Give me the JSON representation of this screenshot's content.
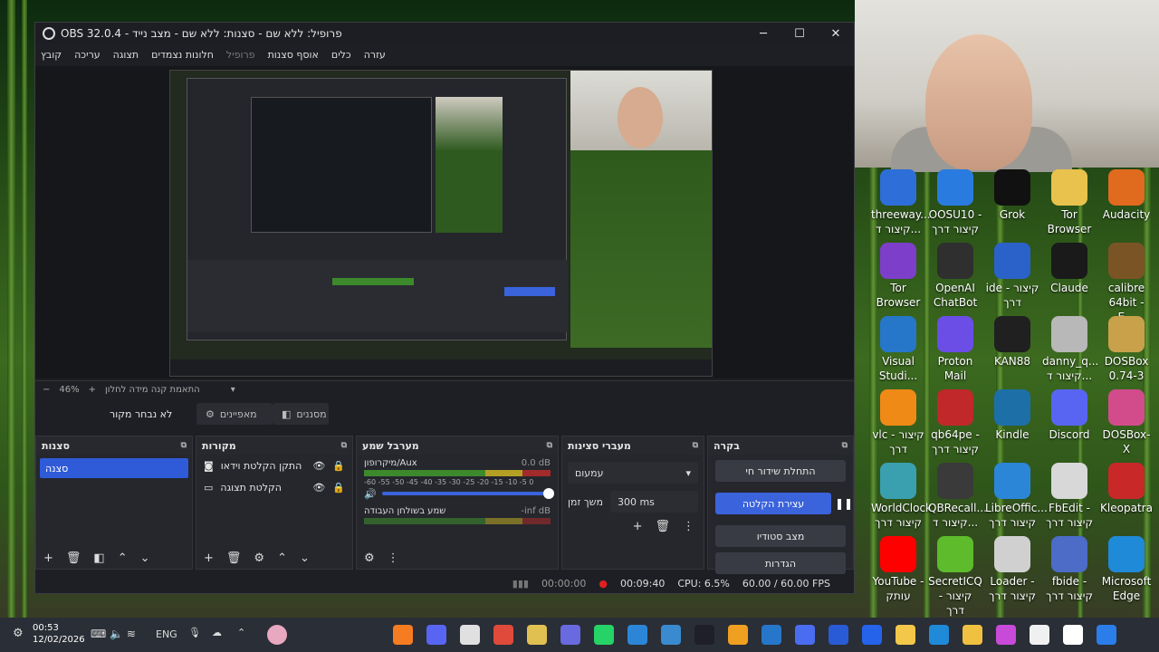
{
  "window": {
    "title": "OBS 32.0.4 - פרופיל: ללא שם - סצנות: ללא שם - מצב נייד"
  },
  "menu": [
    "קובץ",
    "עריכה",
    "תצוגה",
    "חלונות נצמדים",
    "פרופיל",
    "אוסף סצנות",
    "כלים",
    "עזרה"
  ],
  "zoom": {
    "percent": "46%",
    "mode": "התאמת קנה מידה לחלון"
  },
  "source_bar": {
    "no_source": "לא נבחר מקור",
    "properties": "מאפיינים",
    "filters": "מסננים"
  },
  "docks": {
    "scenes": {
      "title": "סצנות",
      "items": [
        "סצנה"
      ]
    },
    "sources": {
      "title": "מקורות",
      "items": [
        "התקן הקלטת וידאו",
        "הקלטת תצוגה"
      ]
    },
    "mixer": {
      "title": "מערבל שמע",
      "ch1_name": "מיקרופון/Aux",
      "ch1_db": "0.0 dB",
      "scale": "-60 -55 -50 -45 -40 -35 -30 -25 -20 -15 -10 -5 0",
      "ch2_name": "שמע בשולחן העבודה",
      "ch2_db": "-inf dB"
    },
    "transitions": {
      "title": "מעברי סצינות",
      "type": "עמעום",
      "duration_label": "משך זמן",
      "duration": "300 ms"
    },
    "controls": {
      "title": "בקרה",
      "stream": "התחלת שידור חי",
      "stop_record": "עצירת הקלטה",
      "studio": "מצב סטודיו",
      "settings": "הגדרות"
    }
  },
  "status": {
    "stream_time": "00:00:00",
    "rec_time": "00:09:40",
    "cpu": "CPU: 6.5%",
    "fps": "60.00 / 60.00 FPS"
  },
  "desktop_icons": [
    {
      "label": "threeway... קיצור ד...",
      "color": "#2e6ed8"
    },
    {
      "label": "OOSU10 - קיצור דרך",
      "color": "#2a7be0"
    },
    {
      "label": "Grok",
      "color": "#111111"
    },
    {
      "label": "Tor Browser",
      "color": "#e8c24c"
    },
    {
      "label": "Audacity",
      "color": "#e06a1e"
    },
    {
      "label": "Tor Browser",
      "color": "#7d3fc9"
    },
    {
      "label": "OpenAI ChatBot",
      "color": "#2f2f2f"
    },
    {
      "label": "ide - קיצור דרך",
      "color": "#2a62c9"
    },
    {
      "label": "Claude",
      "color": "#1a1a1a"
    },
    {
      "label": "calibre 64bit - E...",
      "color": "#7b5426"
    },
    {
      "label": "Visual Studi...",
      "color": "#2677c9"
    },
    {
      "label": "Proton Mail",
      "color": "#6b4ee6"
    },
    {
      "label": "KAN88",
      "color": "#202020"
    },
    {
      "label": "danny_q... קיצור ד...",
      "color": "#b8b8b8"
    },
    {
      "label": "DOSBox 0.74-3",
      "color": "#c8a14a"
    },
    {
      "label": "vlc - קיצור דרך",
      "color": "#f08a16"
    },
    {
      "label": "qb64pe - קיצור דרך",
      "color": "#c0282a"
    },
    {
      "label": "Kindle",
      "color": "#1d6fa8"
    },
    {
      "label": "Discord",
      "color": "#5865f2"
    },
    {
      "label": "DOSBox-X",
      "color": "#d24c8c"
    },
    {
      "label": "WorldClock קיצור דרך",
      "color": "#3aa0b0"
    },
    {
      "label": "QBRecall... קיצור ד...",
      "color": "#3a3a3a"
    },
    {
      "label": "LibreOffic... קיצור דרך",
      "color": "#2c86d8"
    },
    {
      "label": "FbEdit - קיצור דרך",
      "color": "#d8d8d8"
    },
    {
      "label": "Kleopatra",
      "color": "#c82828"
    },
    {
      "label": "YouTube - עותק",
      "color": "#ff0000"
    },
    {
      "label": "SecretICQ - קיצור דרך",
      "color": "#5dbb2c"
    },
    {
      "label": "Loader - קיצור דרך",
      "color": "#d0d0d0"
    },
    {
      "label": "fbide - קיצור דרך",
      "color": "#4c6cc8"
    },
    {
      "label": "Microsoft Edge",
      "color": "#1f8ad8"
    }
  ],
  "taskbar": {
    "time": "00:53",
    "date": "12/02/2026",
    "lang": "ENG"
  }
}
